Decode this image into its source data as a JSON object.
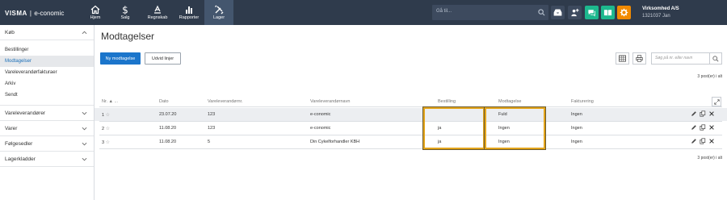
{
  "brand": {
    "visma": "VISMA",
    "separator": "|",
    "product": "e-conomic"
  },
  "nav": [
    {
      "label": "Hjem",
      "icon": "home-icon"
    },
    {
      "label": "Salg",
      "icon": "dollar-icon"
    },
    {
      "label": "Regnskab",
      "icon": "ledger-icon"
    },
    {
      "label": "Rapporter",
      "icon": "bar-chart-icon"
    },
    {
      "label": "Lager",
      "icon": "tools-icon",
      "active": true
    }
  ],
  "topsearch": {
    "placeholder": "Gå til..."
  },
  "toolbar_icons": [
    "inbox-icon",
    "add-user-icon",
    "chat-icon",
    "book-icon",
    "settings-icon"
  ],
  "company": {
    "name": "Virksomhed A/S",
    "id_user": "1321037 Jan"
  },
  "sidebar": {
    "sections": [
      {
        "label": "Køb",
        "expanded": true,
        "items": [
          "Bestillinger",
          "Modtagelser",
          "Vareleverandørfakturaer",
          "Arkiv",
          "Sendt"
        ],
        "active_item": "Modtagelser"
      },
      {
        "label": "Vareleverandører",
        "expanded": false
      },
      {
        "label": "Varer",
        "expanded": false
      },
      {
        "label": "Følgesedler",
        "expanded": false
      },
      {
        "label": "Lagerkladder",
        "expanded": false
      }
    ]
  },
  "main": {
    "title": "Modtagelser",
    "new_button": "Ny modtagelse",
    "expand_button": "Udvid linjer",
    "search_placeholder": "Søg på nr. eller navn",
    "count_text": "3 post(er) i alt",
    "columns": [
      "Nr. ▲",
      "Dato",
      "Vareleverandørnr.",
      "Vareleverandørnavn",
      "Bestilling",
      "Modtagelse",
      "Fakturering"
    ],
    "rows": [
      {
        "nr": "1",
        "dato": "23.07.20",
        "levnr": "123",
        "levnavn": "e-conomic",
        "bestilling": "",
        "modtagelse": "Fuld",
        "fakturering": "Ingen"
      },
      {
        "nr": "2",
        "dato": "11.08.20",
        "levnr": "123",
        "levnavn": "e-conomic",
        "bestilling": "ja",
        "modtagelse": "Ingen",
        "fakturering": "Ingen"
      },
      {
        "nr": "3",
        "dato": "11.08.20",
        "levnr": "5",
        "levnavn": "Din Cykelforhandler KBH",
        "bestilling": "ja",
        "modtagelse": "Ingen",
        "fakturering": "Ingen"
      }
    ]
  },
  "colors": {
    "topbar": "#2f3b4c",
    "primary": "#1b75cb",
    "chat": "#1db88e",
    "book": "#1db88e",
    "settings": "#f18a00",
    "highlight": "#e3a41b"
  }
}
